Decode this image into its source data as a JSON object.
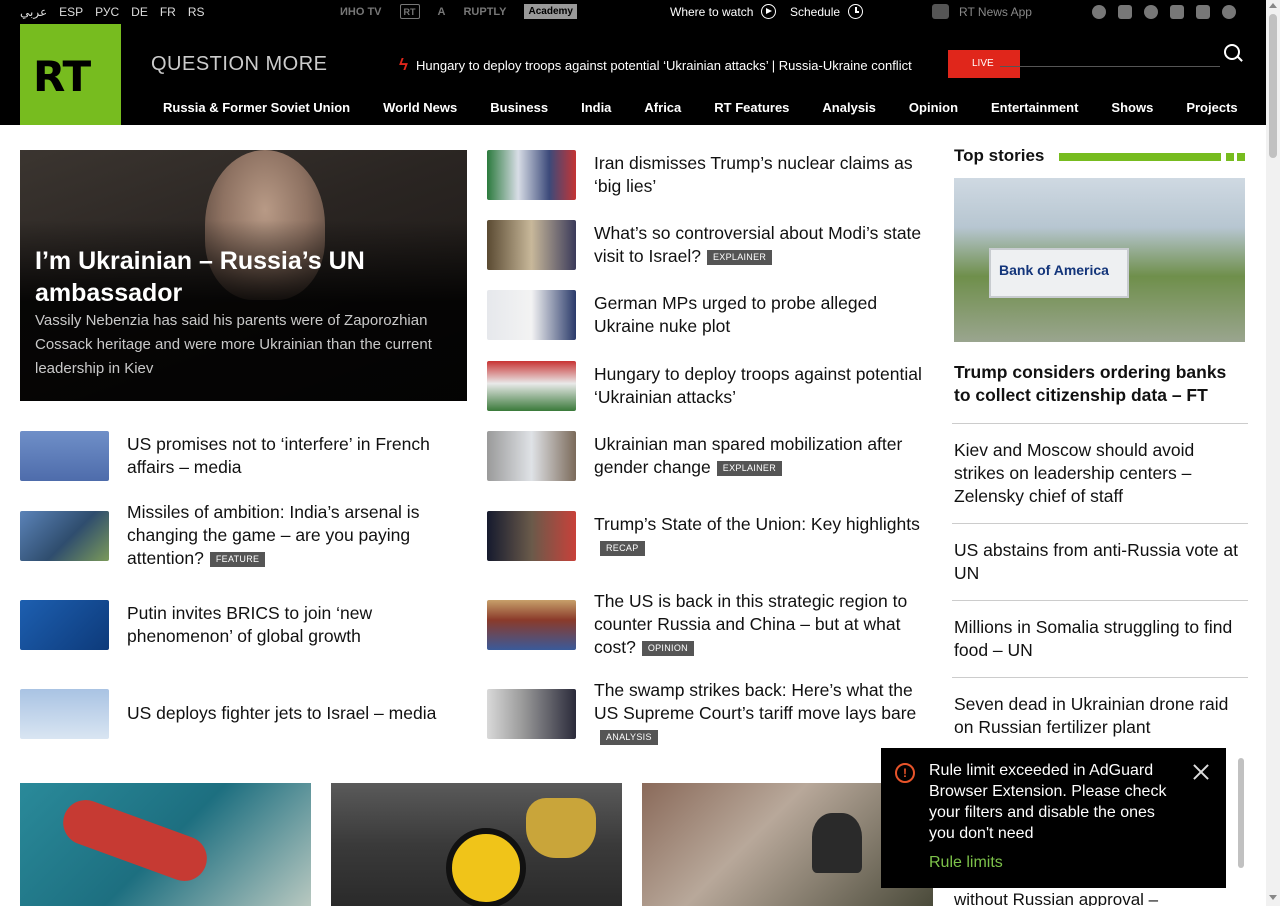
{
  "topbar": {
    "languages": [
      "عربي",
      "ESP",
      "РУС",
      "DE",
      "FR",
      "RS"
    ],
    "partners": [
      "ИНО TV",
      "RT",
      "A",
      "RUPTLY",
      "Academy"
    ],
    "where_to_watch": "Where to watch",
    "schedule": "Schedule",
    "news_app": "RT News App"
  },
  "header": {
    "logo": "RT",
    "tagline": "QUESTION MORE",
    "ticker": "Hungary to deploy troops against potential ‘Ukrainian attacks’ | Russia-Ukraine conflict",
    "live": "LIVE",
    "nav": [
      "Russia & Former Soviet Union",
      "World News",
      "Business",
      "India",
      "Africa",
      "RT Features",
      "Analysis",
      "Opinion",
      "Entertainment",
      "Shows",
      "Projects"
    ]
  },
  "hero": {
    "title": "I’m Ukrainian – Russia’s UN ambassador",
    "subtitle": "Vassily Nebenzia has said his parents were of Zaporozhian Cossack heritage and were more Ukrainian than the current leadership in Kiev"
  },
  "left_stories": [
    {
      "title": "US promises not to ‘interfere’ in French affairs – media",
      "tag": ""
    },
    {
      "title": "Missiles of ambition: India’s arsenal is changing the game – are you paying attention?",
      "tag": "FEATURE"
    },
    {
      "title": "Putin invites BRICS to join ‘new phenomenon’ of global growth",
      "tag": ""
    },
    {
      "title": "US deploys fighter jets to Israel – media",
      "tag": ""
    }
  ],
  "middle_stories": [
    {
      "title": "Iran dismisses Trump’s nuclear claims as ‘big lies’",
      "tag": ""
    },
    {
      "title": "What’s so controversial about Modi’s state visit to Israel?",
      "tag": "EXPLAINER"
    },
    {
      "title": "German MPs urged to probe alleged Ukraine nuke plot",
      "tag": ""
    },
    {
      "title": "Hungary to deploy troops against potential ‘Ukrainian attacks’",
      "tag": ""
    },
    {
      "title": "Ukrainian man spared mobilization after gender change",
      "tag": "EXPLAINER"
    },
    {
      "title": "Trump’s State of the Union: Key highlights",
      "tag": "RECAP"
    },
    {
      "title": "The US is back in this strategic region to counter Russia and China – but at what cost?",
      "tag": "OPINION"
    },
    {
      "title": "The swamp strikes back: Here’s what the US Supreme Court’s tariff move lays bare",
      "tag": "ANALYSIS"
    }
  ],
  "top_stories": {
    "heading": "Top stories",
    "image_sign": "Bank of America",
    "lead": "Trump considers ordering banks to collect citizenship data – FT",
    "items": [
      "Kiev and Moscow should avoid strikes on leadership centers – Zelensky chief of staff",
      "US abstains from anti-Russia vote at UN",
      "Millions in Somalia struggling to find food – UN",
      "Seven dead in Ukrainian drone raid on Russian fertilizer plant"
    ],
    "partial": "without Russian approval –"
  },
  "popup": {
    "message": "Rule limit exceeded in AdGuard Browser Extension. Please check your filters and disable the ones you don't need",
    "link": "Rule limits"
  },
  "colors": {
    "brand_green": "#77bc1f",
    "live_red": "#e0261b",
    "tag_gray": "#555555",
    "popup_link": "#7dc24a"
  }
}
